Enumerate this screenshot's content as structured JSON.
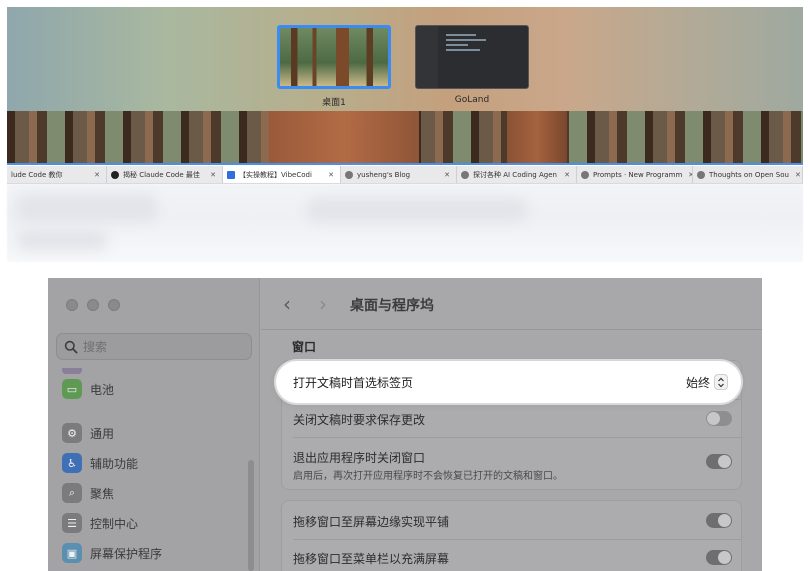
{
  "mission_control": {
    "spaces": [
      {
        "label": "桌面1"
      },
      {
        "label": "GoLand"
      }
    ]
  },
  "browser_tabs": [
    {
      "title": "lude Code 教你 "
    },
    {
      "title": "揭秘 Claude Code 最佳"
    },
    {
      "title": "【实操教程】VibeCodi"
    },
    {
      "title": "yusheng's Blog"
    },
    {
      "title": "探讨各种 AI Coding Agen"
    },
    {
      "title": "Prompts · New Programm"
    },
    {
      "title": "Thoughts on Open Sou"
    }
  ],
  "settings": {
    "search_placeholder": "搜索",
    "sidebar_items": [
      {
        "label": "电池",
        "icon": "battery-icon",
        "color": "#5e9a54"
      },
      {
        "label": "通用",
        "icon": "gear-icon",
        "color": "#7b7b7e"
      },
      {
        "label": "辅助功能",
        "icon": "accessibility-icon",
        "color": "#3f6fb5"
      },
      {
        "label": "聚焦",
        "icon": "magnifier-icon",
        "color": "#7b7b7e"
      },
      {
        "label": "控制中心",
        "icon": "control-center-icon",
        "color": "#7b7b7e"
      },
      {
        "label": "屏幕保护程序",
        "icon": "screensaver-icon",
        "color": "#5a8fb0"
      }
    ],
    "page_title": "桌面与程序坞",
    "section_window": "窗口",
    "rows": {
      "prefer_tabs_label": "打开文稿时首选标签页",
      "prefer_tabs_value": "始终",
      "ask_keep_changes_label": "关闭文稿时要求保存更改",
      "close_windows_label": "退出应用程序时关闭窗口",
      "close_windows_sub": "启用后，再次打开应用程序时不会恢复已打开的文稿和窗口。",
      "tile_edges_label": "拖移窗口至屏幕边缘实现平铺",
      "fill_menubar_label": "拖移窗口至菜单栏以充满屏幕"
    },
    "toggles": {
      "ask_keep_changes": false,
      "close_windows": true,
      "tile_edges": true,
      "fill_menubar": true
    }
  },
  "colors": {
    "accent": "#3b8cf0"
  }
}
